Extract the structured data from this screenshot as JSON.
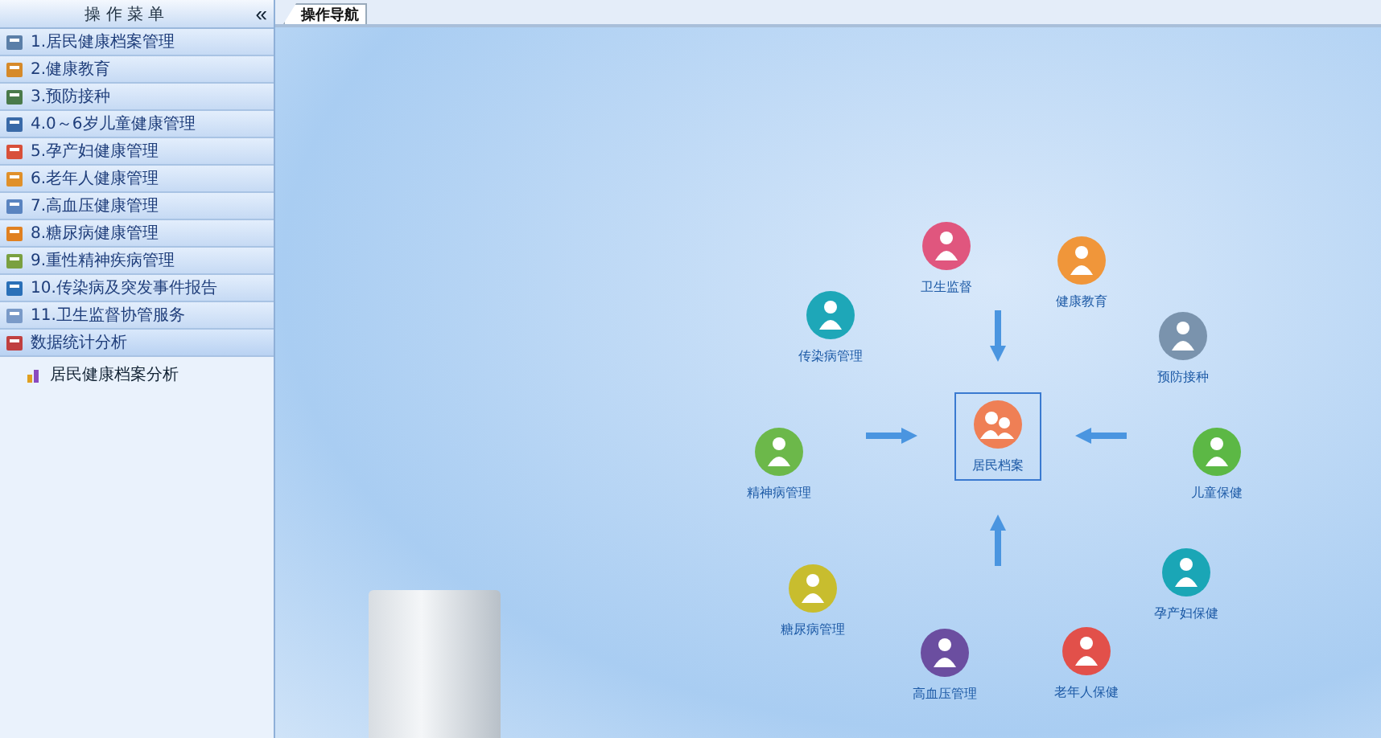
{
  "sidebar": {
    "title": "操 作 菜 单",
    "collapse_glyph": "«",
    "items": [
      {
        "label": "1.居民健康档案管理",
        "expanded": false
      },
      {
        "label": "2.健康教育",
        "expanded": false
      },
      {
        "label": "3.预防接种",
        "expanded": false
      },
      {
        "label": "4.0～6岁儿童健康管理",
        "expanded": false
      },
      {
        "label": "5.孕产妇健康管理",
        "expanded": false
      },
      {
        "label": "6.老年人健康管理",
        "expanded": false
      },
      {
        "label": "7.高血压健康管理",
        "expanded": false
      },
      {
        "label": "8.糖尿病健康管理",
        "expanded": false
      },
      {
        "label": "9.重性精神疾病管理",
        "expanded": false
      },
      {
        "label": "10.传染病及突发事件报告",
        "expanded": false
      },
      {
        "label": "11.卫生监督协管服务",
        "expanded": false
      },
      {
        "label": "数据统计分析",
        "expanded": true,
        "children": [
          {
            "label": "居民健康档案分析"
          }
        ]
      }
    ]
  },
  "tabs": [
    {
      "label": "操作导航",
      "selected": true
    }
  ],
  "navigation": {
    "center": {
      "label": "居民档案",
      "color": "#ef7f55"
    },
    "nodes": [
      {
        "label": "卫生监督",
        "color": "#e0567e"
      },
      {
        "label": "健康教育",
        "color": "#f0963a"
      },
      {
        "label": "传染病管理",
        "color": "#1ea7b8"
      },
      {
        "label": "预防接种",
        "color": "#7a93ad"
      },
      {
        "label": "精神病管理",
        "color": "#6cb84a"
      },
      {
        "label": "儿童保健",
        "color": "#5cb845"
      },
      {
        "label": "糖尿病管理",
        "color": "#c8bd2e"
      },
      {
        "label": "孕产妇保健",
        "color": "#1aa6b6"
      },
      {
        "label": "高血压管理",
        "color": "#6b4ea0"
      },
      {
        "label": "老年人保健",
        "color": "#e2504a"
      }
    ]
  }
}
